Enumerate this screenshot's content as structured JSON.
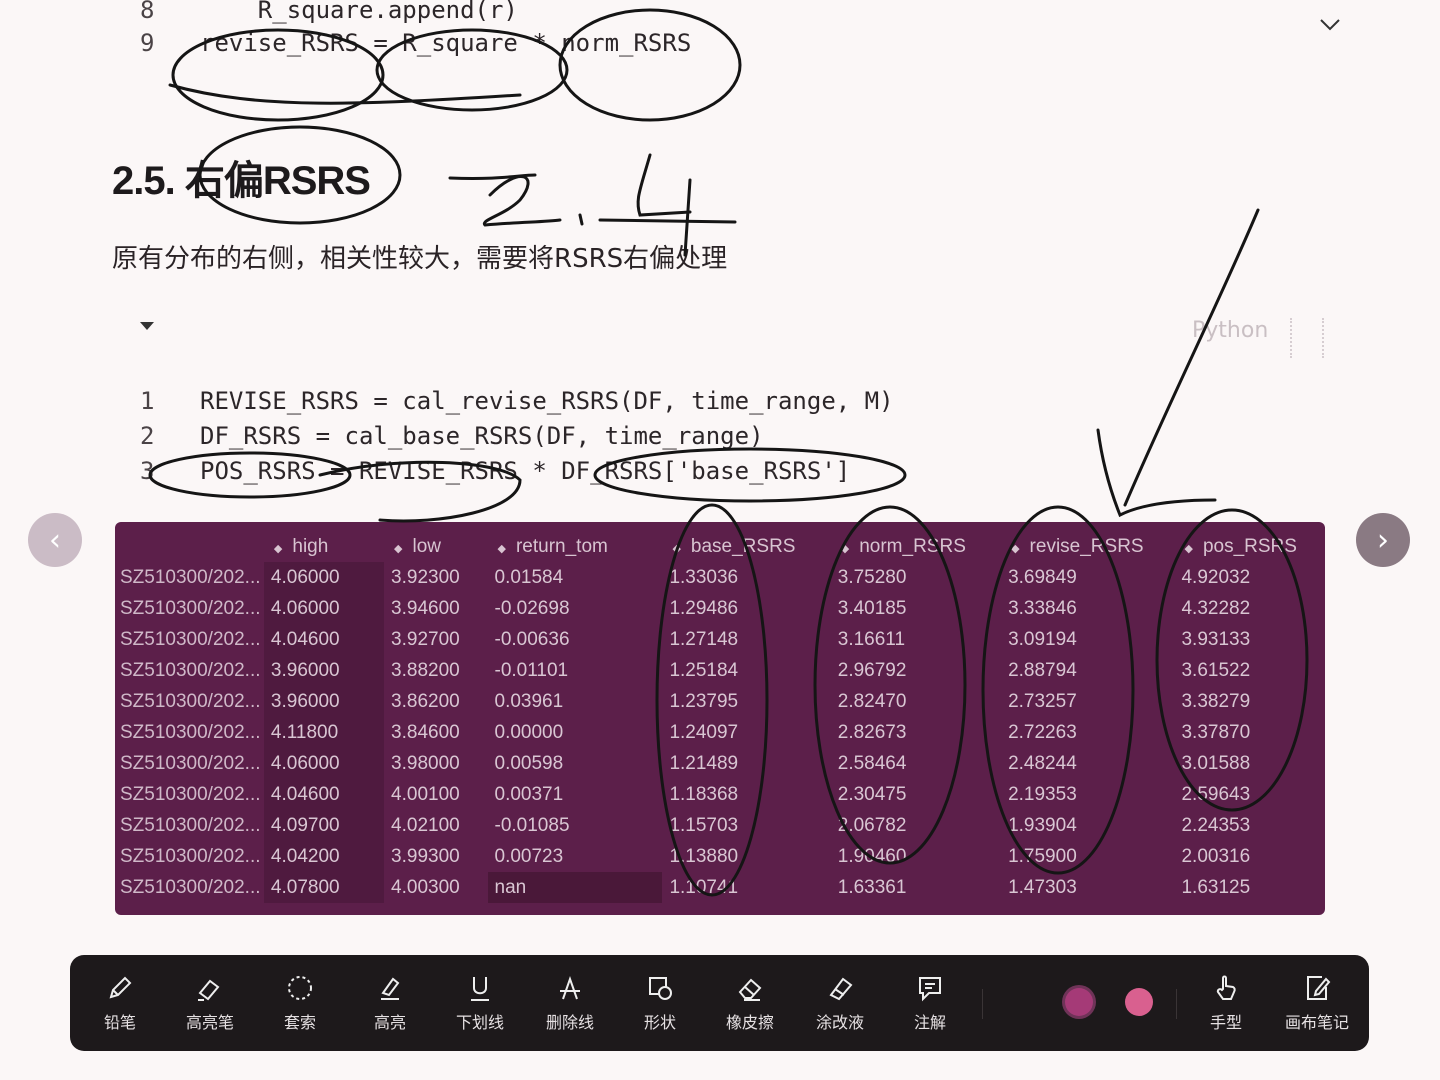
{
  "code_top": [
    {
      "n": "8",
      "text": "    R_square.append(r)"
    },
    {
      "n": "9",
      "text": "revise_RSRS = R_square * norm_RSRS"
    }
  ],
  "heading": "2.5. 右偏RSRS",
  "paragraph": "原有分布的右侧，相关性较大，需要将RSRS右偏处理",
  "language_label": "Python",
  "code_main": [
    {
      "n": "1",
      "text": "REVISE_RSRS = cal_revise_RSRS(DF, time_range, M)"
    },
    {
      "n": "2",
      "text": "DF_RSRS = cal_base_RSRS(DF, time_range)"
    },
    {
      "n": "3",
      "text": "POS_RSRS = REVISE_RSRS * DF_RSRS['base_RSRS']"
    }
  ],
  "table": {
    "columns": [
      "high",
      "low",
      "return_tom",
      "base_RSRS",
      "norm_RSRS",
      "revise_RSRS",
      "pos_RSRS"
    ],
    "rows": [
      [
        "SZ510300/202...",
        "4.06000",
        "3.92300",
        "0.01584",
        "1.33036",
        "3.75280",
        "3.69849",
        "4.92032"
      ],
      [
        "SZ510300/202...",
        "4.06000",
        "3.94600",
        "-0.02698",
        "1.29486",
        "3.40185",
        "3.33846",
        "4.32282"
      ],
      [
        "SZ510300/202...",
        "4.04600",
        "3.92700",
        "-0.00636",
        "1.27148",
        "3.16611",
        "3.09194",
        "3.93133"
      ],
      [
        "SZ510300/202...",
        "3.96000",
        "3.88200",
        "-0.01101",
        "1.25184",
        "2.96792",
        "2.88794",
        "3.61522"
      ],
      [
        "SZ510300/202...",
        "3.96000",
        "3.86200",
        "0.03961",
        "1.23795",
        "2.82470",
        "2.73257",
        "3.38279"
      ],
      [
        "SZ510300/202...",
        "4.11800",
        "3.84600",
        "0.00000",
        "1.24097",
        "2.82673",
        "2.72263",
        "3.37870"
      ],
      [
        "SZ510300/202...",
        "4.06000",
        "3.98000",
        "0.00598",
        "1.21489",
        "2.58464",
        "2.48244",
        "3.01588"
      ],
      [
        "SZ510300/202...",
        "4.04600",
        "4.00100",
        "0.00371",
        "1.18368",
        "2.30475",
        "2.19353",
        "2.59643"
      ],
      [
        "SZ510300/202...",
        "4.09700",
        "4.02100",
        "-0.01085",
        "1.15703",
        "2.06782",
        "1.93904",
        "2.24353"
      ],
      [
        "SZ510300/202...",
        "4.04200",
        "3.99300",
        "0.00723",
        "1.13880",
        "1.90460",
        "1.75900",
        "2.00316"
      ],
      [
        "SZ510300/202...",
        "4.07800",
        "4.00300",
        "nan",
        "1.10741",
        "1.63361",
        "1.47303",
        "1.63125"
      ]
    ]
  },
  "toolbar": {
    "tools": [
      {
        "label": "铅笔",
        "icon": "pencil-icon"
      },
      {
        "label": "高亮笔",
        "icon": "highlighter-icon"
      },
      {
        "label": "套索",
        "icon": "lasso-icon"
      },
      {
        "label": "高亮",
        "icon": "highlight-icon"
      },
      {
        "label": "下划线",
        "icon": "underline-icon"
      },
      {
        "label": "删除线",
        "icon": "strikethrough-icon"
      },
      {
        "label": "形状",
        "icon": "shape-icon"
      },
      {
        "label": "橡皮擦",
        "icon": "eraser-icon"
      },
      {
        "label": "涂改液",
        "icon": "correction-fluid-icon"
      },
      {
        "label": "注解",
        "icon": "annotation-icon"
      }
    ],
    "colors": [
      "#a53a77",
      "#d9608f"
    ],
    "right_tools": [
      {
        "label": "手型",
        "icon": "hand-icon"
      },
      {
        "label": "画布笔记",
        "icon": "canvas-note-icon"
      }
    ]
  },
  "colors": {
    "table_bg": "#5c1f4a",
    "ink": "#1a1a1a"
  }
}
